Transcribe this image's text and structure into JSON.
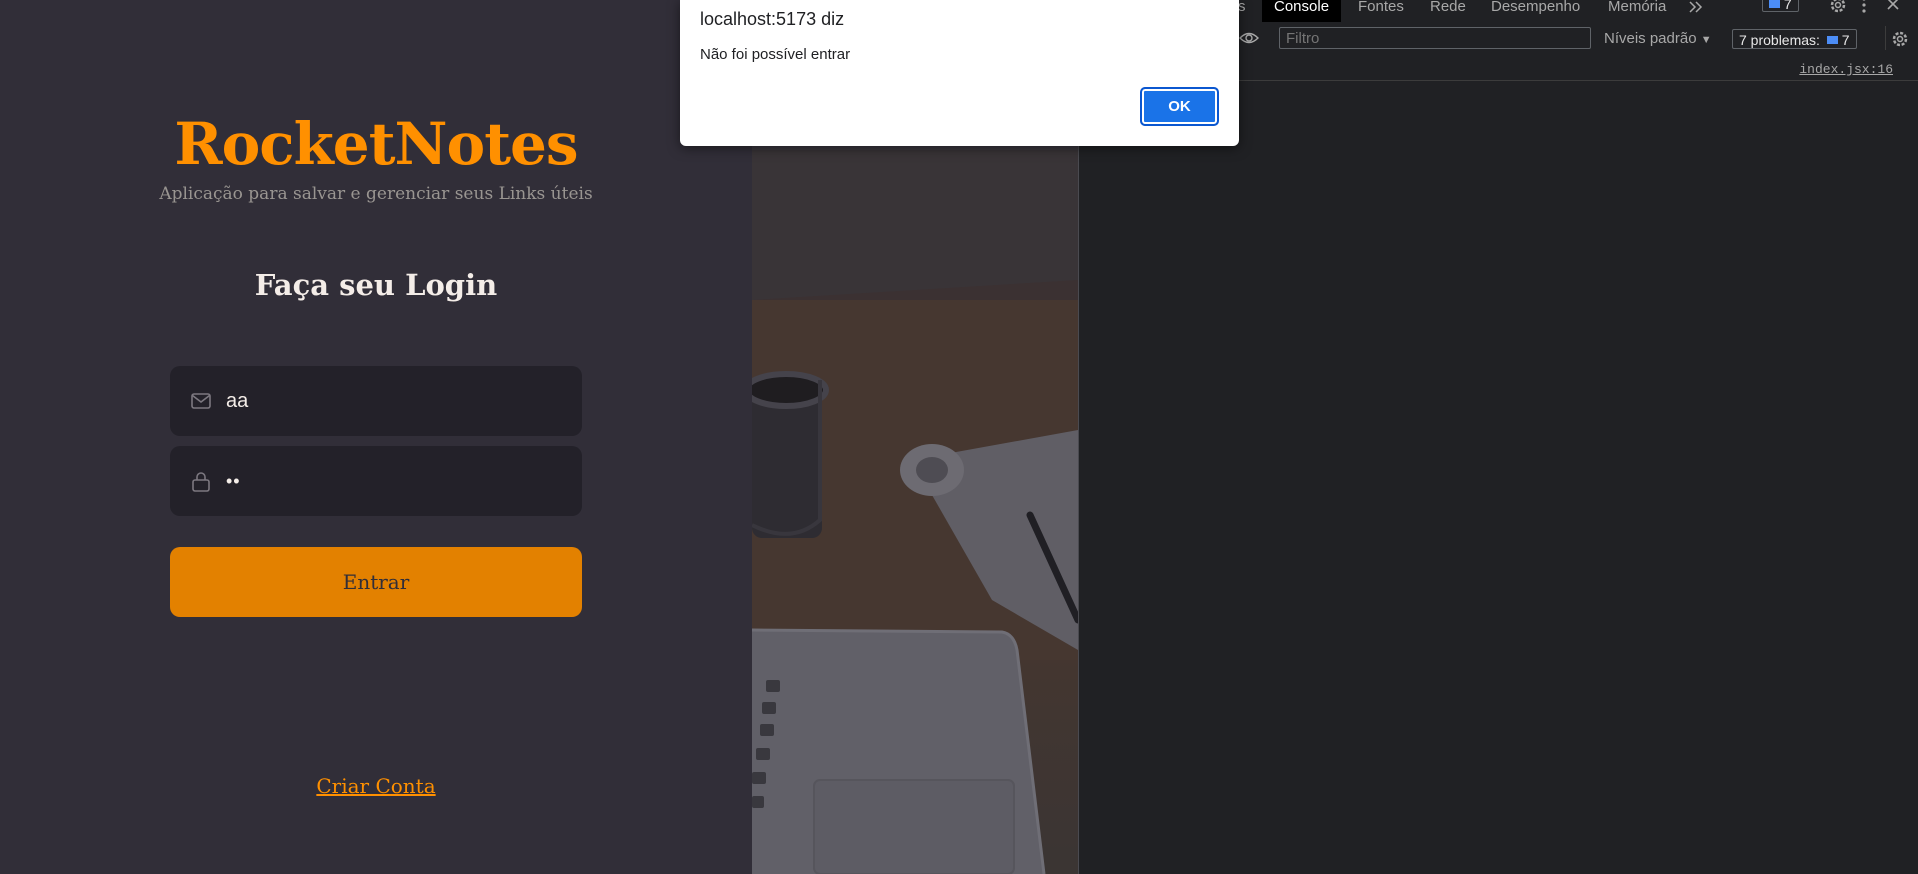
{
  "app": {
    "title": "RocketNotes",
    "subtitle": "Aplicação para salvar e gerenciar seus Links úteis",
    "login_heading": "Faça seu Login",
    "email_value": "aa",
    "password_value": "••",
    "submit_label": "Entrar",
    "signup_link": "Criar Conta",
    "colors": {
      "accent": "#ff9000",
      "button": "#e38100",
      "panel": "#312e38",
      "input_bg": "#232129"
    }
  },
  "devtools": {
    "tabs": [
      "s",
      "Console",
      "Fontes",
      "Rede",
      "Desempenho",
      "Memória"
    ],
    "active_tab": "Console",
    "issues_badge_count": "7",
    "filter_placeholder": "Filtro",
    "levels_label": "Níveis padrão",
    "problems_label": "7 problemas:",
    "problems_count": "7",
    "source_link": "index.jsx:16"
  },
  "alert": {
    "title": "localhost:5173 diz",
    "message": "Não foi possível entrar",
    "ok_label": "OK"
  },
  "icons": [
    "mail-icon",
    "lock-icon",
    "eye-icon",
    "more-tabs-icon",
    "message-icon",
    "settings-icon",
    "kebab-menu-icon",
    "close-icon"
  ]
}
